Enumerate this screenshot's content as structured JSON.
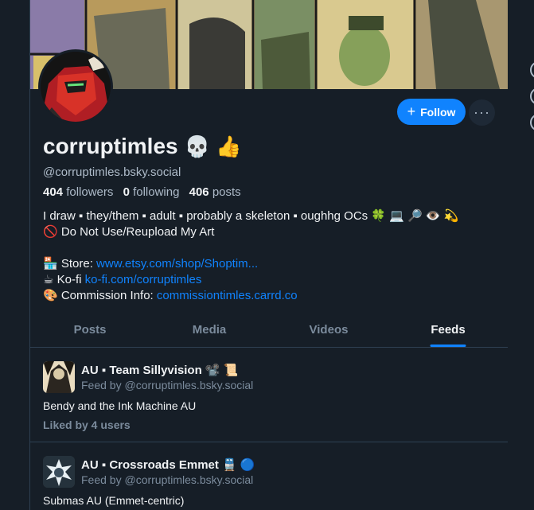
{
  "profile": {
    "display_name": "corruptimles",
    "name_emoji": "💀 👍",
    "handle": "@corruptimles.bsky.social",
    "followers_count": "404",
    "followers_label": "followers",
    "following_count": "0",
    "following_label": "following",
    "posts_count": "406",
    "posts_label": "posts"
  },
  "actions": {
    "follow_label": "Follow",
    "more_label": "···"
  },
  "bio": {
    "line1": "I draw ▪ they/them ▪ adult ▪ probably a skeleton ▪ oughhg OCs 🍀 💻 🔎 👁️ 💫",
    "line2": "🚫 Do Not Use/Reupload My Art",
    "store_prefix": "🏪 Store: ",
    "store_link": "www.etsy.com/shop/Shoptim...",
    "kofi_prefix": "☕ Ko-fi ",
    "kofi_link": "ko-fi.com/corruptimles",
    "commission_prefix": "🎨 Commission Info: ",
    "commission_link": "commissiontimles.carrd.co"
  },
  "tabs": [
    {
      "label": "Posts",
      "active": false
    },
    {
      "label": "Media",
      "active": false
    },
    {
      "label": "Videos",
      "active": false
    },
    {
      "label": "Feeds",
      "active": true
    }
  ],
  "feeds": [
    {
      "title": "AU ▪ Team Sillyvision 📽️ 📜",
      "byline": "Feed by @corruptimles.bsky.social",
      "description": "Bendy and the Ink Machine AU",
      "likes": "Liked by 4 users"
    },
    {
      "title": "AU ▪ Crossroads Emmet 🚆 🔵",
      "byline": "Feed by @corruptimles.bsky.social",
      "description": "Submas AU (Emmet-centric)"
    }
  ],
  "colors": {
    "background": "#161e27",
    "accent": "#1083fe",
    "muted_text": "#7b8b9c",
    "border": "#2e4052"
  },
  "icons": [
    "plus-icon",
    "more-horizontal-icon"
  ]
}
